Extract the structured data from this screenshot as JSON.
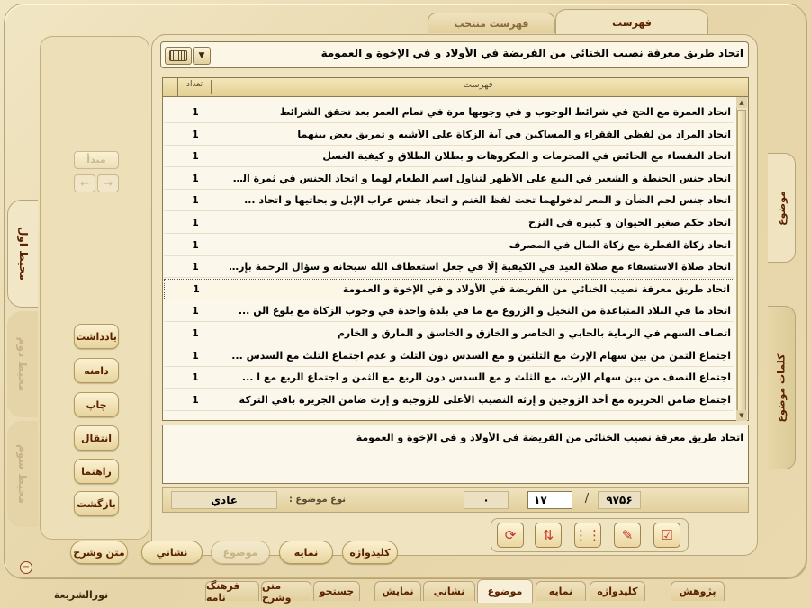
{
  "top_tabs": {
    "active": "فهرست",
    "other": "فهرست منتخب"
  },
  "header_query": "اتحاد طريق معرفة نصيب الخنائي من الفريضة في الأولاد و في الإخوة و العمومة",
  "table": {
    "col_title": "فهرست",
    "col_count": "تعداد",
    "rows": [
      {
        "title": "اتحاد العمرة مع الحج في شرائط الوجوب و في وجوبها مرة في تمام العمر بعد تحقق الشرائط",
        "count": "1"
      },
      {
        "title": "اتحاد المراد من لفظي الفقراء و المساكين في آية الزكاة على الأشبه و تمريق بعض بينهما",
        "count": "1"
      },
      {
        "title": "اتحاد النفساء مع الحائض في المحرمات و المكروهات و بطلان الطلاق و كيفية الغسل",
        "count": "1"
      },
      {
        "title": "اتحاد جنس الحنطة و الشعير في البيع على الأظهر لتناول اسم الطعام لهما و اتحاد الجنس في ثمرة الن ...",
        "count": "1"
      },
      {
        "title": "اتحاد جنس لحم الضأن و المعز لدخولهما تحت لفظ الغنم و اتحاد جنس عراب الإبل و بخاتيها و اتحاد ...",
        "count": "1"
      },
      {
        "title": "اتحاد حكم صغير الحيوان و كبيره في النزح",
        "count": "1"
      },
      {
        "title": "اتحاد زكاة الفطرة مع زكاة المال في المصرف",
        "count": "1"
      },
      {
        "title": "اتحاد صلاة الاستسقاء مع صلاة العيد في الكيفية إلّا في جعل استعطاف الله سبحانه و سؤال الرحمة بإر ...",
        "count": "1"
      },
      {
        "title": "اتحاد طريق معرفة نصيب الخنائي من الفريضة في الأولاد و في الإخوة و العمومة",
        "count": "1"
      },
      {
        "title": "اتحاد ما في البلاد المتباعدة من النخيل و الزروع مع ما في بلدة واحدة في وجوب الزكاة مع بلوغ الن ...",
        "count": "1"
      },
      {
        "title": "اتصاف السهم في الرماية بالحابي و الخاصر و الخازق و الخاسق و المارق و الخارم",
        "count": "1"
      },
      {
        "title": "اجتماع الثمن من بين سهام الإرث مع الثلثين و مع السدس دون الثلث و عدم اجتماع الثلث مع السدس ...",
        "count": "1"
      },
      {
        "title": "اجتماع النصف من بين سهام الإرث، مع الثلث و مع السدس دون الربع مع الثمن و اجتماع الربع مع ا ...",
        "count": "1"
      },
      {
        "title": "اجتماع ضامن الجريرة مع أحد الزوجين و إرثه النصيب الأعلى للزوجية و إرث ضامن الجريرة باقي التركة",
        "count": "1"
      }
    ]
  },
  "preview_text": "اتحاد طريق معرفة نصيب الخنائي من الفريضة في الأولاد و في الإخوة و العمومة",
  "status": {
    "topic_type_label": "نوع موضوع :",
    "topic_type_value": "عادي",
    "total": "۹۷۵۶",
    "current": "۱۷",
    "separator": "/",
    "zero": "۰"
  },
  "left_panel": {
    "mabda": "مبدأ",
    "buttons": [
      "يادداشت",
      "دامنه",
      "چاپ",
      "انتقال",
      "راهنما",
      "بازگشت"
    ]
  },
  "vertical_tabs": [
    "محيط اول",
    "محيط دوم",
    "محيط سوم"
  ],
  "right_tabs": [
    "موضوع",
    "كلمات موضوع"
  ],
  "action_pills": [
    "كليدواژه",
    "نمايه",
    "موضوع",
    "نشاني",
    "متن وشرح"
  ],
  "bottom_tabs": [
    "پژوهش",
    "كليدواژه",
    "نمايه",
    "موضوع",
    "نشاني",
    "نمايش",
    "جستجو",
    "متن وشرح",
    "فرهنگ نامه"
  ],
  "app_name": "نورالشريعة",
  "colors": {
    "accent": "#5a2200",
    "panel": "#efe3c0",
    "frame": "#e6d5a8"
  }
}
